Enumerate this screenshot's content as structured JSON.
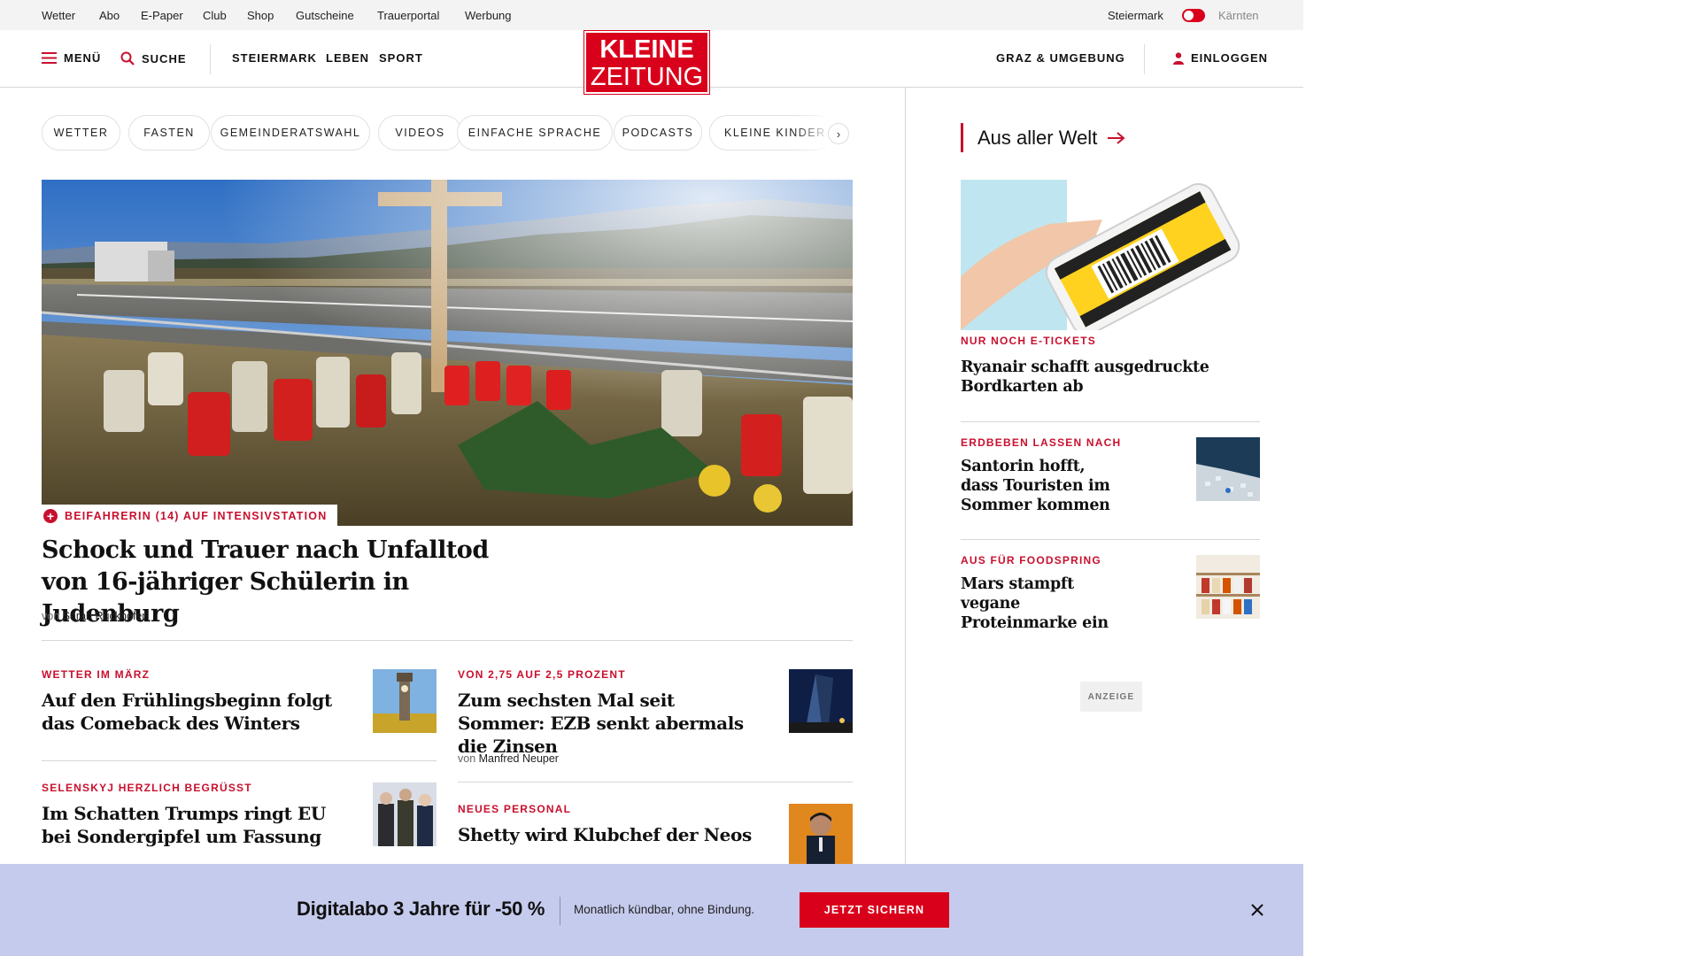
{
  "topbar": {
    "links": [
      "Wetter",
      "Abo",
      "E-Paper",
      "Club",
      "Shop",
      "Gutscheine",
      "Trauerportal",
      "Werbung"
    ],
    "region_active": "Steiermark",
    "region_other": "Kärnten"
  },
  "header": {
    "menu_label": "MENÜ",
    "search_label": "SUCHE",
    "nav": [
      "STEIERMARK",
      "LEBEN",
      "SPORT"
    ],
    "logo_line1": "KLEINE",
    "logo_line2": "ZEITUNG",
    "local_label": "GRAZ & UMGEBUNG",
    "login_label": "EINLOGGEN"
  },
  "chips": [
    "WETTER",
    "FASTEN",
    "GEMEINDERATSWAHL",
    "VIDEOS",
    "EINFACHE SPRACHE",
    "PODCASTS",
    "KLEINE KINDER"
  ],
  "chips_next_icon": "chevron-right-icon",
  "hero": {
    "kicker": "BEIFAHRERIN (14) AUF INTENSIVSTATION",
    "title": "Schock und Trauer nach Unfalltod von 16-jähriger Schülerin in Judenburg",
    "byline_prefix": "von",
    "author": "Sarah Ruckhofer"
  },
  "teasers": [
    {
      "kicker": "WETTER IM MÄRZ",
      "title": "Auf den Frühlingsbeginn folgt das Comeback des Winters"
    },
    {
      "kicker": "VON 2,75 AUF 2,5 PROZENT",
      "title": "Zum sechsten Mal seit Sommer: EZB senkt abermals die Zinsen",
      "byline_prefix": "von",
      "author": "Manfred Neuper"
    },
    {
      "kicker": "SELENSKYJ HERZLICH BEGRÜSST",
      "title": "Im Schatten Trumps ringt EU bei Sondergipfel um Fassung"
    },
    {
      "kicker": "NEUES PERSONAL",
      "title": "Shetty wird Klubchef der Neos"
    }
  ],
  "sidebar": {
    "heading": "Aus aller Welt",
    "items": [
      {
        "kicker": "NUR NOCH E-TICKETS",
        "title": "Ryanair schafft ausgedruckte Bordkarten ab"
      },
      {
        "kicker": "ERDBEBEN LASSEN NACH",
        "title": "Santorin hofft, dass Touristen im Sommer kommen"
      },
      {
        "kicker": "AUS FÜR FOODSPRING",
        "title": "Mars stampft vegane Proteinmarke ein"
      }
    ],
    "ad_label": "ANZEIGE"
  },
  "promo": {
    "headline": "Digitalabo 3 Jahre für -50 %",
    "subline": "Monatlich kündbar, ohne Bindung.",
    "cta": "JETZT SICHERN"
  },
  "colors": {
    "brand_red": "#d9001b",
    "kicker_red": "#c8102e",
    "promo_bg": "#c5cbed"
  }
}
